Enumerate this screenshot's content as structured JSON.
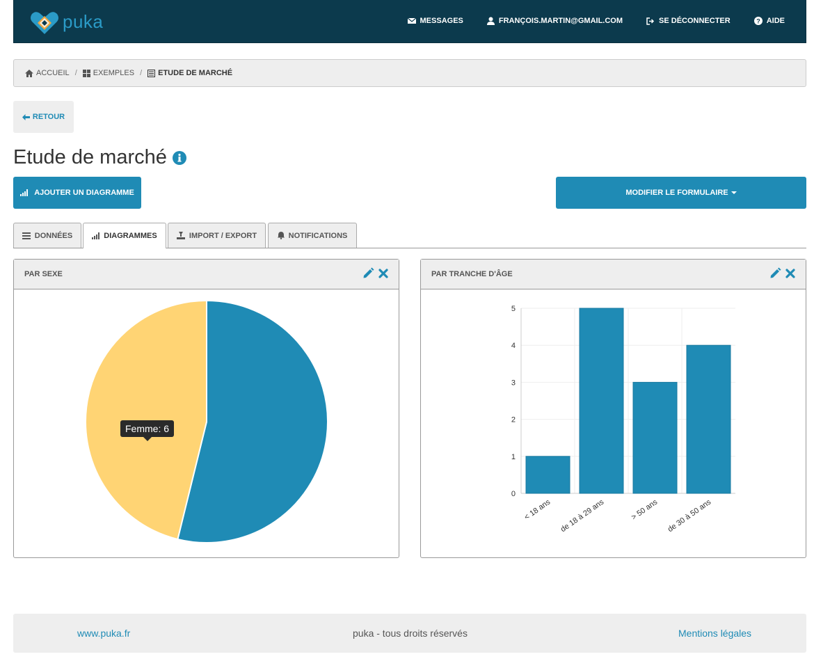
{
  "brand": {
    "name": "puka"
  },
  "nav": {
    "messages": "MESSAGES",
    "user": "FRANÇOIS.MARTIN@GMAIL.COM",
    "logout": "SE DÉCONNECTER",
    "help": "AIDE"
  },
  "breadcrumb": {
    "home": "ACCUEIL",
    "examples": "EXEMPLES",
    "current": "ETUDE DE MARCHÉ",
    "sep": "/"
  },
  "back_label": "RETOUR",
  "page_title": "Etude de marché",
  "actions": {
    "add_chart": "AJOUTER UN DIAGRAMME",
    "edit_form": "MODIFIER LE FORMULAIRE"
  },
  "tabs": [
    {
      "label": "DONNÉES",
      "icon": "list-icon"
    },
    {
      "label": "DIAGRAMMES",
      "icon": "bar-chart-icon"
    },
    {
      "label": "IMPORT / EXPORT",
      "icon": "import-export-icon"
    },
    {
      "label": "NOTIFICATIONS",
      "icon": "bell-icon"
    }
  ],
  "active_tab": 1,
  "colors": {
    "primary": "#1f8bb5",
    "navbar": "#0c3a4d",
    "yellow": "#ffd474"
  },
  "panels": {
    "sex": {
      "title": "PAR SEXE"
    },
    "age": {
      "title": "PAR TRANCHE D'ÂGE"
    }
  },
  "chart_data": [
    {
      "type": "pie",
      "title": "PAR SEXE",
      "slices": [
        {
          "label": "Femme",
          "value": 6,
          "color": "#ffd474"
        },
        {
          "label": "",
          "value": 7,
          "color": "#1f8bb5"
        }
      ],
      "tooltip": "Femme: 6"
    },
    {
      "type": "bar",
      "title": "PAR TRANCHE D'ÂGE",
      "categories": [
        "< 18 ans",
        "de 18 à 29 ans",
        "> 50 ans",
        "de 30 à 50 ans"
      ],
      "values": [
        1,
        5,
        3,
        4
      ],
      "ylim": [
        0,
        5
      ],
      "yticks": [
        0,
        1,
        2,
        3,
        4,
        5
      ],
      "grid": true,
      "color": "#1f8bb5"
    }
  ],
  "footer": {
    "site": "www.puka.fr",
    "rights": "puka - tous droits réservés",
    "legal": "Mentions légales"
  }
}
